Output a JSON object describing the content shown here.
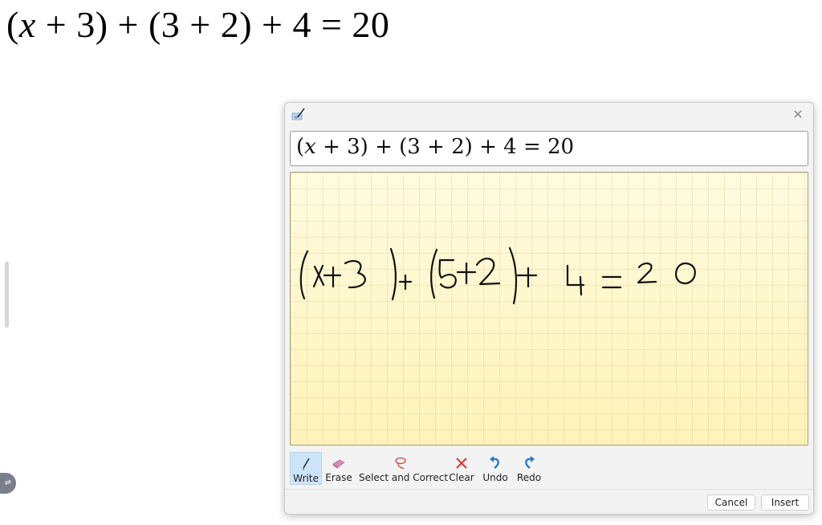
{
  "document": {
    "equation_parts": [
      "(",
      "x",
      " + 3) + (3 + 2) + 4 = 20"
    ]
  },
  "dialog": {
    "title_icon": "math-input-panel-icon",
    "close_label": "✕",
    "preview": {
      "parts": [
        "(",
        "x",
        " + 3) + (3 + 2) + 4 = 20"
      ]
    },
    "canvas": {
      "handwritten_text": "(x+3)+(5+2)+4=20",
      "ink_color": "#000000",
      "background_color": "#fff7c8"
    },
    "toolbar": {
      "tools": [
        {
          "id": "write",
          "label": "Write",
          "icon": "pen-icon",
          "active": true
        },
        {
          "id": "erase",
          "label": "Erase",
          "icon": "eraser-icon",
          "active": false
        },
        {
          "id": "select",
          "label": "Select and Correct",
          "icon": "lasso-icon",
          "active": false
        },
        {
          "id": "clear",
          "label": "Clear",
          "icon": "x-icon",
          "active": false
        },
        {
          "id": "undo",
          "label": "Undo",
          "icon": "undo-icon",
          "active": false
        },
        {
          "id": "redo",
          "label": "Redo",
          "icon": "redo-icon",
          "active": false
        }
      ]
    },
    "footer": {
      "cancel_label": "Cancel",
      "insert_label": "Insert"
    }
  },
  "side_toggle": {
    "icon": "swap-arrows-icon",
    "glyph": "⇌"
  }
}
